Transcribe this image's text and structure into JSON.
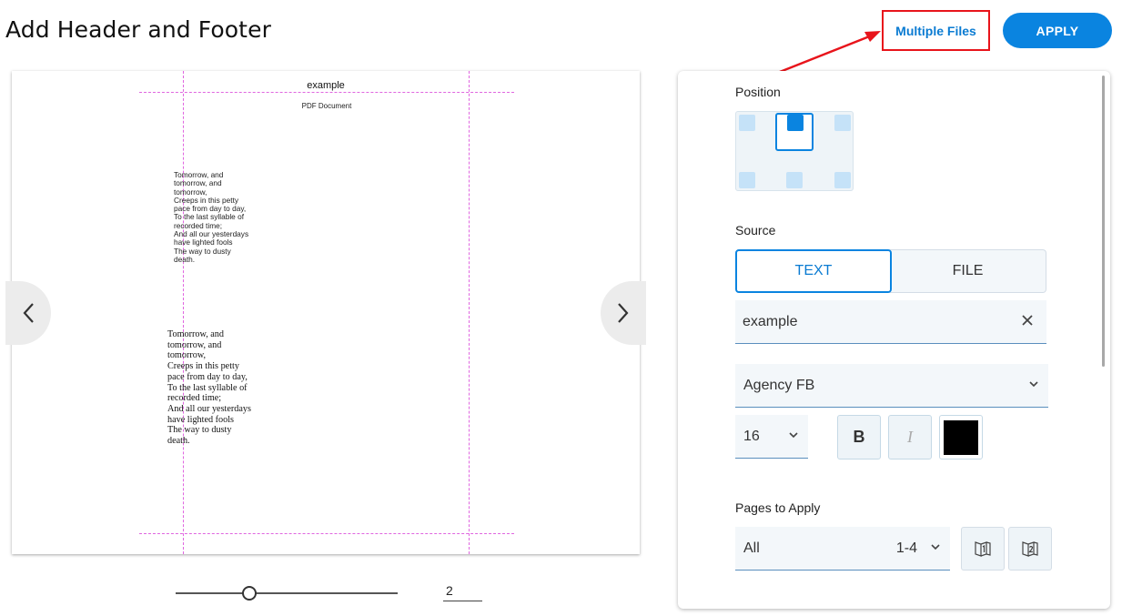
{
  "header": {
    "title": "Add Header and Footer",
    "multiple_files_label": "Multiple Files",
    "apply_label": "APPLY"
  },
  "preview": {
    "header_text": "example",
    "doc_title": "PDF Document",
    "poem_lines": [
      "Tomorrow, and",
      "tomorrow, and",
      "tomorrow,",
      "Creeps in this petty",
      "pace from day to day,",
      "To the last syllable of",
      "recorded time;",
      "And all our yesterdays",
      "have lighted fools",
      "The way to dusty",
      "death."
    ],
    "page_number": "2"
  },
  "panel": {
    "position_label": "Position",
    "source_label": "Source",
    "source_tabs": {
      "text": "TEXT",
      "file": "FILE"
    },
    "text_value": "example",
    "font_value": "Agency FB",
    "size_value": "16",
    "bold_label": "B",
    "italic_label": "I",
    "text_color": "#000000",
    "pages_label": "Pages to Apply",
    "pages_value": "All",
    "pages_range": "1-4"
  },
  "colors": {
    "accent": "#0a84e0",
    "annotation": "#e8141b",
    "guide": "#e066e0"
  }
}
